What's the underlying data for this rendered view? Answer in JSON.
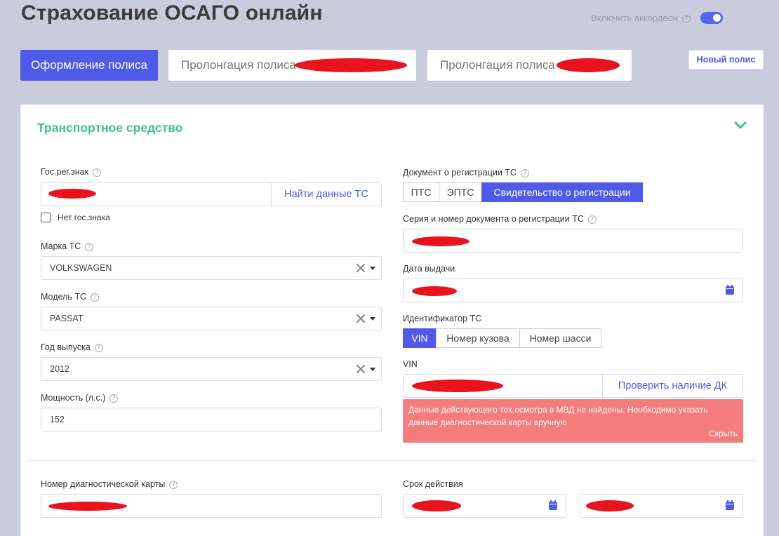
{
  "page": {
    "title": "Страхование ОСАГО онлайн"
  },
  "accordion": {
    "label": "Включить аккордеон",
    "enabled": true
  },
  "tabs": {
    "issue": "Оформление полиса",
    "prolong1": "Пролонгация полиса",
    "prolong2": "Пролонгация полиса",
    "new_policy": "Новый полис"
  },
  "section": {
    "title": "Транспортное средство"
  },
  "left": {
    "reg_plate_label": "Гос.рег.знак",
    "find_button": "Найти данные ТС",
    "no_plate_label": "Нет гос.знака",
    "brand_label": "Марка ТС",
    "brand_value": "VOLKSWAGEN",
    "model_label": "Модель ТС",
    "model_value": "PASSAT",
    "year_label": "Год выпуска",
    "year_value": "2012",
    "power_label": "Мощность (л.с.)",
    "power_value": "152",
    "diag_label": "Номер диагностической карты"
  },
  "right": {
    "doc_label": "Документ о регистрации ТС",
    "doc_options": [
      "ПТС",
      "ЭПТС",
      "Свидетельство о регистрации"
    ],
    "doc_selected": "Свидетельство о регистрации",
    "series_label": "Серия и номер документа о регистрации ТС",
    "issue_date_label": "Дата выдачи",
    "id_label": "Идентификатор ТС",
    "id_options": [
      "VIN",
      "Номер кузова",
      "Номер шасси"
    ],
    "id_selected": "VIN",
    "vin_label": "VIN",
    "check_button": "Проверить наличие ДК",
    "alert_text": "Данные действующего тех.осмотра в МВД не найдены. Необходимо указать данные диагностической карты вручную",
    "alert_hide": "Скрыть",
    "validity_label": "Срок действия"
  },
  "colors": {
    "accent": "#4f5be8",
    "section_title": "#3fbf95",
    "alert": "#f47c7c",
    "redaction": "#e8131d"
  }
}
